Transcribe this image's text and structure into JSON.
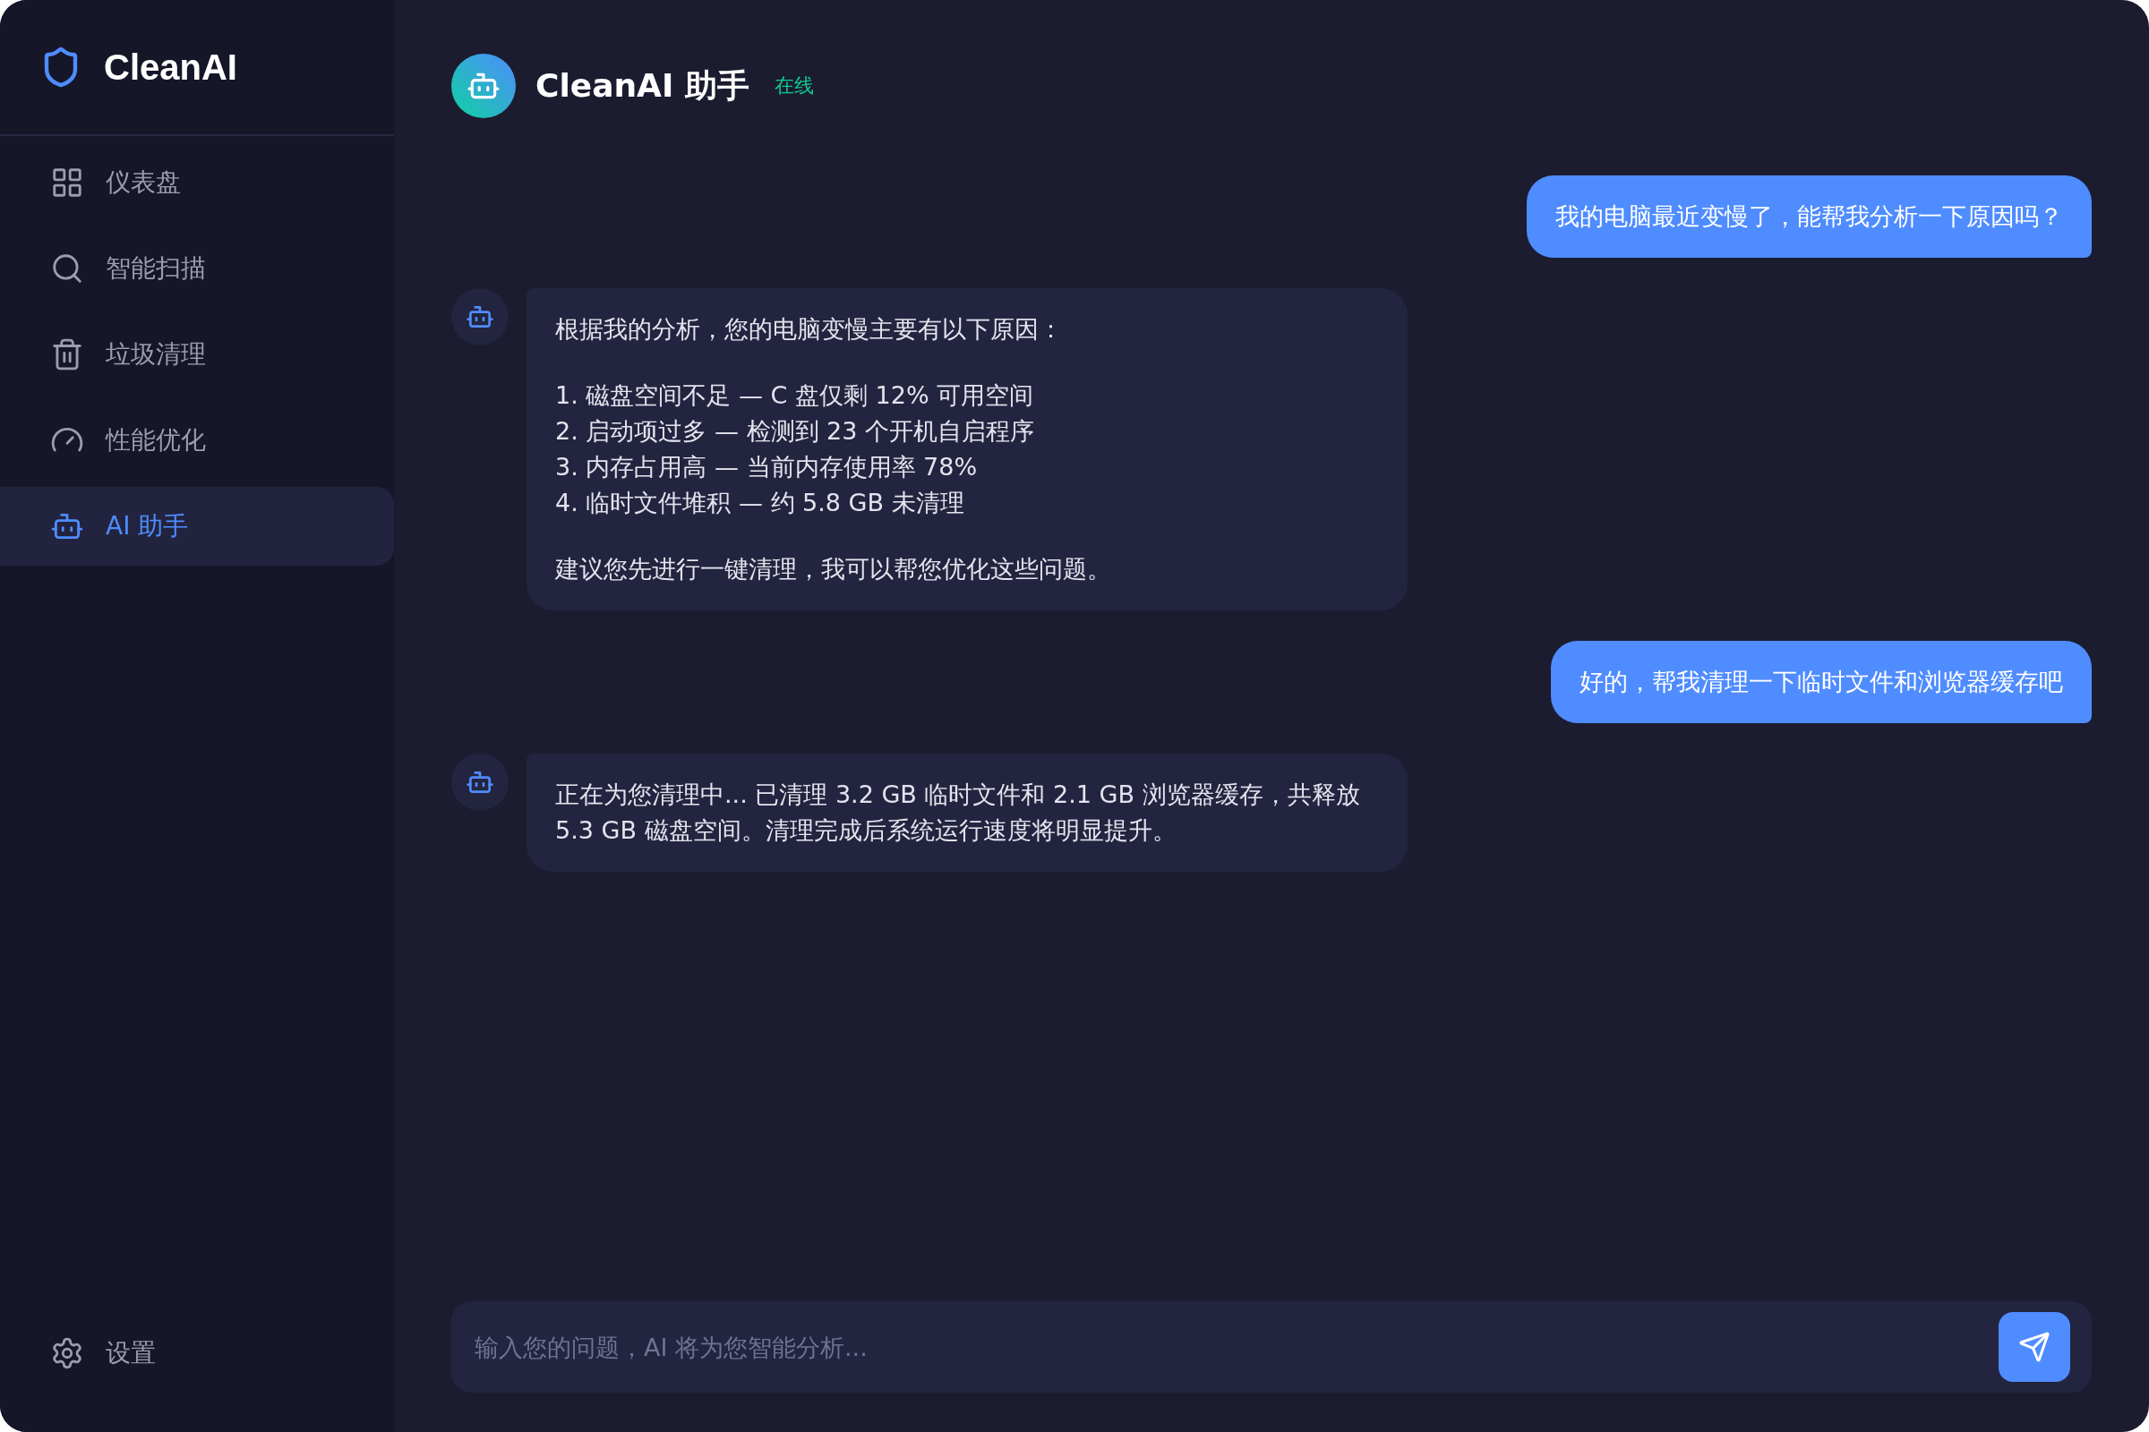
{
  "sidebar": {
    "logo": "CleanAI",
    "items": [
      {
        "label": "仪表盘",
        "selected": false
      },
      {
        "label": "智能扫描",
        "selected": false
      },
      {
        "label": "垃圾清理",
        "selected": false
      },
      {
        "label": "性能优化",
        "selected": false
      },
      {
        "label": "AI 助手",
        "selected": true
      }
    ],
    "settings": "设置"
  },
  "header": {
    "title": "CleanAI 助手",
    "status": "在线"
  },
  "messages": [
    {
      "kind": "user",
      "paragraphs": [
        "我的电脑最近变慢了，能帮我分析一下原因吗？"
      ]
    },
    {
      "kind": "bot",
      "paragraphs": [
        "根据我的分析，您的电脑变慢主要有以下原因：",
        "1. 磁盘空间不足 — C 盘仅剩 12% 可用空间\n2. 启动项过多 — 检测到 23 个开机自启程序\n3. 内存占用高 — 当前内存使用率 78%\n4. 临时文件堆积 — 约 5.8 GB 未清理",
        "建议您先进行一键清理，我可以帮您优化这些问题。"
      ]
    },
    {
      "kind": "user",
      "paragraphs": [
        "好的，帮我清理一下临时文件和浏览器缓存吧"
      ]
    },
    {
      "kind": "bot",
      "paragraphs": [
        "正在为您清理中... 已清理 3.2 GB 临时文件和 2.1 GB 浏览器缓存，共释放 5.3 GB 磁盘空间。清理完成后系统运行速度将明显提升。"
      ]
    }
  ],
  "input": {
    "placeholder": "输入您的问题，AI 将为您智能分析..."
  }
}
